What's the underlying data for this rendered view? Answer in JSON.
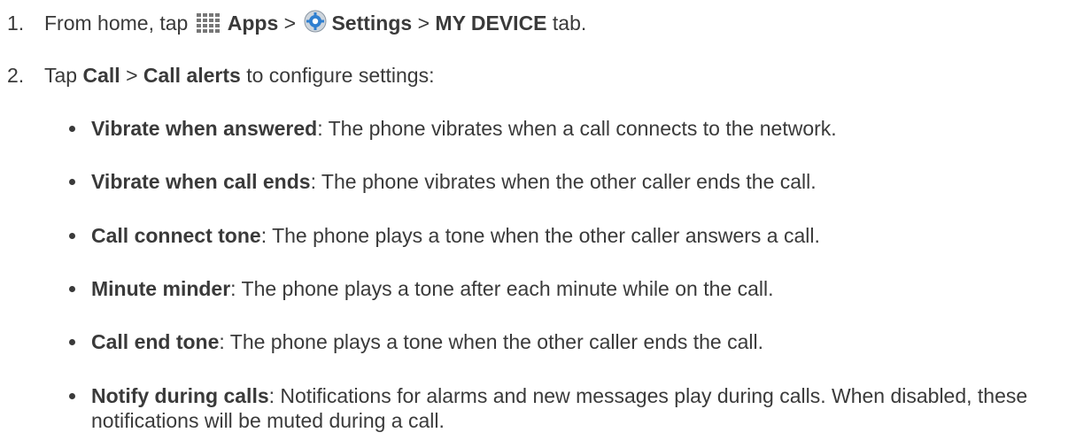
{
  "steps": [
    {
      "number": "1.",
      "t1": "From home, tap",
      "apps_label": "Apps",
      "sep1": ">",
      "settings_label": "Settings",
      "sep2": ">",
      "tab_label": "MY DEVICE",
      "t2": "tab."
    },
    {
      "number": "2.",
      "t1": "Tap",
      "call_label": "Call",
      "sep": ">",
      "alerts_label": "Call alerts",
      "t2": "to configure settings:"
    }
  ],
  "bullets": [
    {
      "term": "Vibrate when answered",
      "desc": ": The phone vibrates when a call connects to the network."
    },
    {
      "term": "Vibrate when call ends",
      "desc": ": The phone vibrates when the other caller ends the call."
    },
    {
      "term": "Call connect tone",
      "desc": ": The phone plays a tone when the other caller answers a call."
    },
    {
      "term": "Minute minder",
      "desc": ": The phone plays a tone after each minute while on the call."
    },
    {
      "term": "Call end tone",
      "desc": ": The phone plays a tone when the other caller ends the call."
    },
    {
      "term": "Notify during calls",
      "desc": ": Notifications for alarms and new messages play during calls. When disabled, these notifications will be muted during a call."
    }
  ],
  "icons": {
    "apps": "apps-grid-icon",
    "settings": "settings-gear-icon"
  },
  "colors": {
    "text": "#3a3a3a",
    "settings_icon_blue": "#2f7fd0"
  }
}
